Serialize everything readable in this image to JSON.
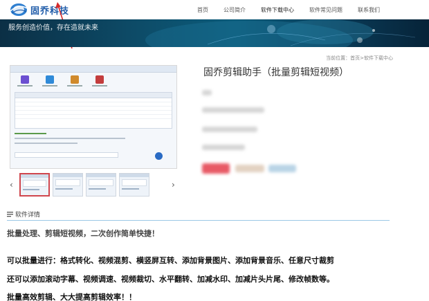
{
  "header": {
    "logo_text": "固乔科技",
    "nav": [
      {
        "label": "首页",
        "active": false
      },
      {
        "label": "公司简介",
        "active": false
      },
      {
        "label": "软件下载中心",
        "active": true
      },
      {
        "label": "软件常见问题",
        "active": false
      },
      {
        "label": "联系我们",
        "active": false
      }
    ]
  },
  "banner": {
    "slogan": "服务创造价值，存在造就未来"
  },
  "breadcrumb": "当前位置：首页>软件下载中心",
  "product": {
    "title": "固乔剪辑助手（批量剪辑短视频）",
    "thumbnail_count": 4,
    "selected_thumbnail": 1
  },
  "carousel": {
    "prev_glyph": "‹",
    "next_glyph": "›"
  },
  "details": {
    "section_label": "软件详情",
    "headline": "批量处理、剪辑短视频，二次创作简单快捷！",
    "features": [
      "可以批量进行：格式转化、视频混剪、横竖屏互转、添加背景图片、添加背景音乐、任意尺寸裁剪",
      "还可以添加滚动字幕、视频调速、视频裁切、水平翻转、加减水印、加减片头片尾、修改帧数等。",
      "批量高效剪辑、大大提高剪辑效率！！"
    ]
  },
  "colors": {
    "brand_blue": "#1d5aa8",
    "banner_dark": "#0b2f45",
    "selected_thumb_border": "#d0464d",
    "detail_divider": "#9bc8e6"
  }
}
